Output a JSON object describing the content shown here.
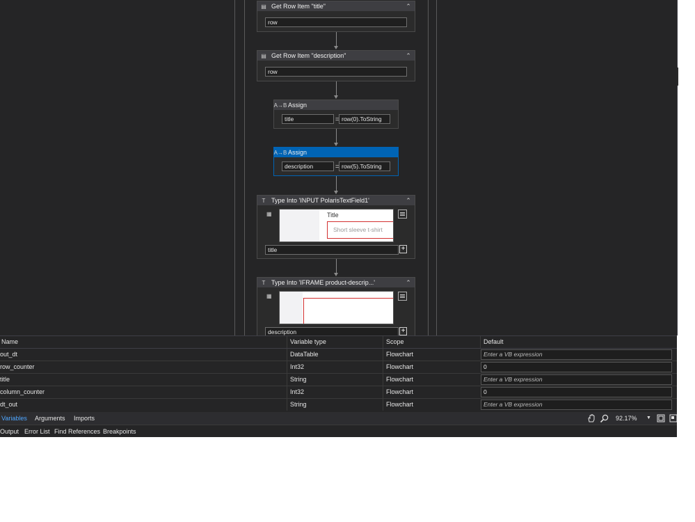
{
  "workflow": {
    "activities": [
      {
        "title": "Get Row Item \"title\"",
        "input": "row"
      },
      {
        "title": "Get Row Item \"description\"",
        "input": "row"
      },
      {
        "title": "Assign",
        "to": "title",
        "value": "row(0).ToString"
      },
      {
        "title": "Assign",
        "to": "description",
        "value": "row(5).ToString"
      },
      {
        "title": "Type Into 'INPUT  PolarisTextField1'",
        "preview_label": "Title",
        "preview_placeholder": "Short sleeve t-shirt",
        "text": "title"
      },
      {
        "title": "Type Into 'IFRAME  product-descrip...'",
        "text": "description"
      }
    ],
    "selected_index": 3,
    "accent_selected": "#0064b5",
    "highlight_red": "#d32f2f"
  },
  "variables": {
    "columns": [
      "Name",
      "Variable type",
      "Scope",
      "Default"
    ],
    "rows": [
      {
        "name": "out_dt",
        "type": "DataTable",
        "scope": "Flowchart",
        "default": "",
        "placeholder": "Enter a VB expression"
      },
      {
        "name": "row_counter",
        "type": "Int32",
        "scope": "Flowchart",
        "default": "0",
        "placeholder": ""
      },
      {
        "name": "title",
        "type": "String",
        "scope": "Flowchart",
        "default": "",
        "placeholder": "Enter a VB expression"
      },
      {
        "name": "column_counter",
        "type": "Int32",
        "scope": "Flowchart",
        "default": "0",
        "placeholder": ""
      },
      {
        "name": "dt_out",
        "type": "String",
        "scope": "Flowchart",
        "default": "",
        "placeholder": "Enter a VB expression"
      }
    ]
  },
  "designer_tabs": [
    "Variables",
    "Arguments",
    "Imports"
  ],
  "active_tab": "Variables",
  "zoom": "92.17%",
  "bottom_tabs": [
    "Output",
    "Error List",
    "Find References",
    "Breakpoints"
  ]
}
